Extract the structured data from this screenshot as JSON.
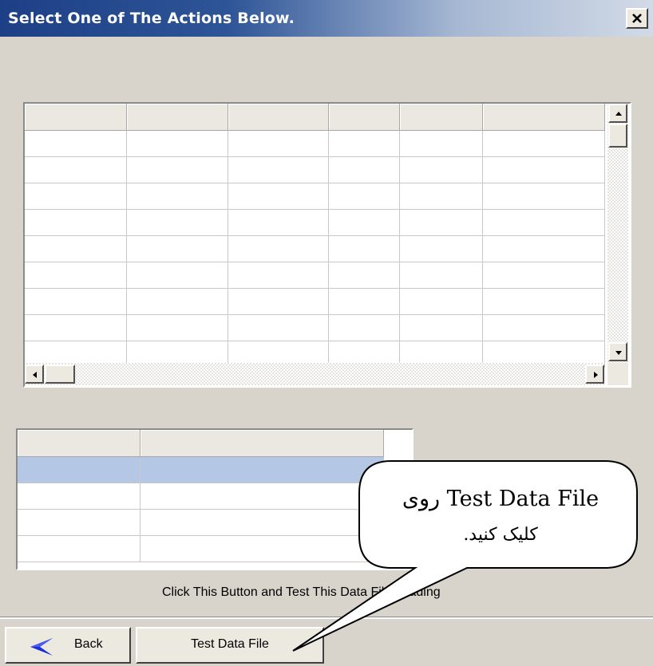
{
  "window": {
    "title": "Select One of The Actions Below."
  },
  "hint_text": "Click This Button and Test This Data File Loading",
  "buttons": {
    "back_label": "Back",
    "test_label": "Test Data File"
  },
  "callout": {
    "line1": "روی  Test Data File",
    "line2": "کلیک کنید."
  },
  "icons": {
    "close": "close-icon",
    "back": "back-arrow-icon",
    "scroll_up": "scroll-up-icon",
    "scroll_down": "scroll-down-icon",
    "scroll_left": "scroll-left-icon",
    "scroll_right": "scroll-right-icon"
  },
  "colors": {
    "title_gradient_start": "#1d3f86",
    "selected_row": "#b4c8e6",
    "back_arrow": "#1a2fd6"
  }
}
